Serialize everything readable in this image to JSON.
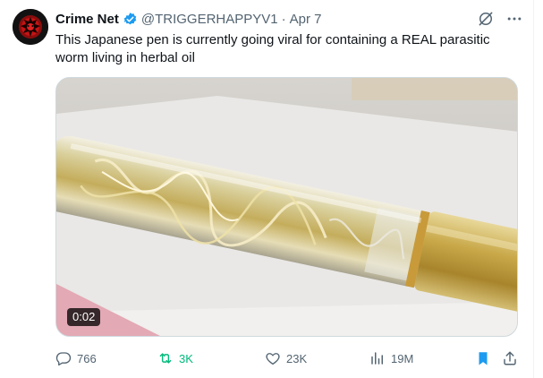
{
  "tweet": {
    "author_name": "Crime Net",
    "handle": "@TRIGGERHAPPYV1",
    "separator": "·",
    "time": "Apr 7",
    "text": "This Japanese pen is currently going viral for containing a REAL parasitic worm living in herbal oil",
    "verified": true
  },
  "media": {
    "type": "video",
    "duration": "0:02"
  },
  "actions": {
    "replies": "766",
    "retweets": "3K",
    "likes": "23K",
    "views": "19M",
    "bookmarked": true
  },
  "colors": {
    "verified": "#1d9bf0",
    "retweet_active": "#00ba7c",
    "bookmark_active": "#1d9bf0",
    "muted": "#536471"
  },
  "icons": [
    "grok-icon",
    "more-icon",
    "reply-icon",
    "retweet-icon",
    "like-icon",
    "views-icon",
    "bookmark-icon",
    "share-icon"
  ]
}
